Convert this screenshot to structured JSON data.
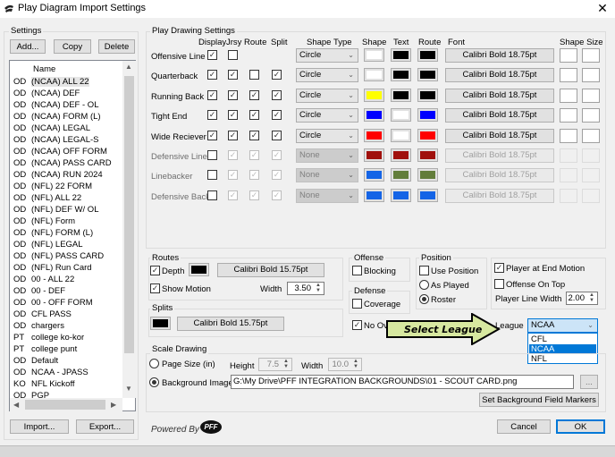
{
  "window": {
    "title": "Play Diagram Import Settings",
    "close_glyph": "✕"
  },
  "settings": {
    "group_label": "Settings",
    "add_label": "Add...",
    "copy_label": "Copy",
    "delete_label": "Delete",
    "column_header": "Name",
    "items": [
      {
        "code": "OD",
        "name": "(NCAA) ALL 22",
        "selected": true
      },
      {
        "code": "OD",
        "name": "(NCAA) DEF"
      },
      {
        "code": "OD",
        "name": "(NCAA) DEF - OL"
      },
      {
        "code": "OD",
        "name": "(NCAA) FORM (L)"
      },
      {
        "code": "OD",
        "name": "(NCAA) LEGAL"
      },
      {
        "code": "OD",
        "name": "(NCAA) LEGAL-S"
      },
      {
        "code": "OD",
        "name": "(NCAA) OFF FORM"
      },
      {
        "code": "OD",
        "name": "(NCAA) PASS CARD"
      },
      {
        "code": "OD",
        "name": "(NCAA) RUN 2024"
      },
      {
        "code": "OD",
        "name": "(NFL) 22 FORM"
      },
      {
        "code": "OD",
        "name": "(NFL) ALL 22"
      },
      {
        "code": "OD",
        "name": "(NFL) DEF W/ OL"
      },
      {
        "code": "OD",
        "name": "(NFL) Form"
      },
      {
        "code": "OD",
        "name": "(NFL) FORM (L)"
      },
      {
        "code": "OD",
        "name": "(NFL) LEGAL"
      },
      {
        "code": "OD",
        "name": "(NFL) PASS CARD"
      },
      {
        "code": "OD",
        "name": "(NFL) Run Card"
      },
      {
        "code": "OD",
        "name": "00 - ALL 22"
      },
      {
        "code": "OD",
        "name": "00 - DEF"
      },
      {
        "code": "OD",
        "name": "00 - OFF FORM"
      },
      {
        "code": "OD",
        "name": "CFL PASS"
      },
      {
        "code": "OD",
        "name": "chargers"
      },
      {
        "code": "PT",
        "name": "college ko-kor"
      },
      {
        "code": "PT",
        "name": "college punt"
      },
      {
        "code": "OD",
        "name": "Default"
      },
      {
        "code": "OD",
        "name": "NCAA - JPASS"
      },
      {
        "code": "KO",
        "name": "NFL Kickoff"
      },
      {
        "code": "OD",
        "name": "PGP"
      }
    ],
    "import_label": "Import...",
    "export_label": "Export..."
  },
  "play_drawing": {
    "group_label": "Play Drawing Settings",
    "headers": {
      "display": "Display",
      "jrsy": "Jrsy",
      "route": "Route",
      "split": "Split",
      "shape_type": "Shape Type",
      "shape": "Shape",
      "text": "Text",
      "route_color": "Route",
      "font": "Font",
      "shape_size": "Shape Size"
    },
    "rows": [
      {
        "label": "Offensive Line",
        "enabled": true,
        "display": true,
        "jrsy": false,
        "route": null,
        "split": null,
        "shape_type": "Circle",
        "shape_color": "#ffffff",
        "text_color": "#000000",
        "route_color": "#000000",
        "font": "Calibri Bold 18.75pt"
      },
      {
        "label": "Quarterback",
        "enabled": true,
        "display": true,
        "jrsy": true,
        "route": false,
        "split": true,
        "shape_type": "Circle",
        "shape_color": "#ffffff",
        "text_color": "#000000",
        "route_color": "#000000",
        "font": "Calibri Bold 18.75pt"
      },
      {
        "label": "Running Back",
        "enabled": true,
        "display": true,
        "jrsy": true,
        "route": true,
        "split": true,
        "shape_type": "Circle",
        "shape_color": "#ffff00",
        "text_color": "#000000",
        "route_color": "#000000",
        "font": "Calibri Bold 18.75pt"
      },
      {
        "label": "Tight End",
        "enabled": true,
        "display": true,
        "jrsy": true,
        "route": true,
        "split": true,
        "shape_type": "Circle",
        "shape_color": "#0000ff",
        "text_color": "#ffffff",
        "route_color": "#0000ff",
        "font": "Calibri Bold 18.75pt"
      },
      {
        "label": "Wide Reciever",
        "enabled": true,
        "display": true,
        "jrsy": true,
        "route": true,
        "split": true,
        "shape_type": "Circle",
        "shape_color": "#ff0000",
        "text_color": "#ffffff",
        "route_color": "#ff0000",
        "font": "Calibri Bold 18.75pt"
      },
      {
        "label": "Defensive Line",
        "enabled": false,
        "display": false,
        "jrsy": true,
        "route": true,
        "split": true,
        "shape_type": "None",
        "shape_color": "#a0100c",
        "text_color": "#a0100c",
        "route_color": "#a0100c",
        "font": "Calibri Bold 18.75pt"
      },
      {
        "label": "Linebacker",
        "enabled": false,
        "display": false,
        "jrsy": true,
        "route": true,
        "split": true,
        "shape_type": "None",
        "shape_color": "#1464e6",
        "text_color": "#627d3a",
        "route_color": "#627d3a",
        "font": "Calibri Bold 18.75pt"
      },
      {
        "label": "Defensive Back",
        "enabled": false,
        "display": false,
        "jrsy": true,
        "route": true,
        "split": true,
        "shape_type": "None",
        "shape_color": "#1464e6",
        "text_color": "#1464e6",
        "route_color": "#1464e6",
        "font": "Calibri Bold 18.75pt"
      }
    ]
  },
  "routes": {
    "group_label": "Routes",
    "depth_label": "Depth",
    "depth_checked": true,
    "depth_color": "#000000",
    "font": "Calibri Bold 15.75pt",
    "show_motion_label": "Show Motion",
    "show_motion_checked": true,
    "width_label": "Width",
    "width_value": "3.50"
  },
  "splits": {
    "group_label": "Splits",
    "color": "#000000",
    "font": "Calibri Bold 15.75pt"
  },
  "offense": {
    "group_label": "Offense",
    "blocking_label": "Blocking",
    "blocking_checked": false
  },
  "defense": {
    "group_label": "Defense",
    "coverage_label": "Coverage",
    "coverage_checked": false
  },
  "no_overlap": {
    "label": "No Ov",
    "checked": true
  },
  "position": {
    "group_label": "Position",
    "use_position_label": "Use Position",
    "use_position_checked": false,
    "as_played_label": "As Played",
    "roster_label": "Roster",
    "selected": "Roster"
  },
  "misc": {
    "end_motion_label": "Player at End Motion",
    "end_motion_checked": true,
    "offense_top_label": "Offense On Top",
    "offense_top_checked": false,
    "line_width_label": "Player Line Width",
    "line_width_value": "2.00"
  },
  "league": {
    "label": "League",
    "selected": "NCAA",
    "options": [
      "CFL",
      "NCAA",
      "NFL"
    ],
    "arrow_glyph": "⌄"
  },
  "callout": {
    "text": "Select League",
    "fill": "#d7e8a0"
  },
  "scale": {
    "group_label": "Scale Drawing",
    "page_size_label": "Page Size (in)",
    "height_label": "Height",
    "height_value": "7.5",
    "width_label": "Width",
    "width_value": "10.0",
    "bg_image_label": "Background Image",
    "bg_image_path": "G:\\My Drive\\PFF INTEGRATION BACKGROUNDS\\01 - SCOUT CARD.png",
    "browse_label": "...",
    "selected": "Background Image",
    "markers_label": "Set Background Field Markers"
  },
  "footer": {
    "powered_by": "Powered By",
    "brand": "PFF",
    "cancel_label": "Cancel",
    "ok_label": "OK"
  }
}
